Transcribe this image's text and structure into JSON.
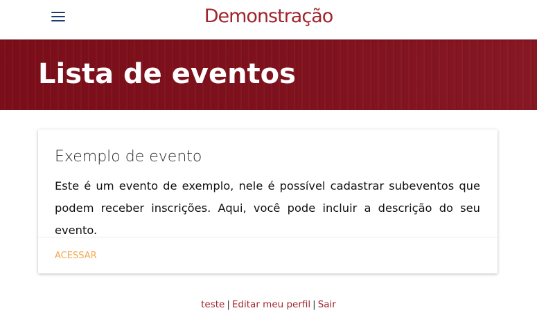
{
  "header": {
    "brand": "Demonstração",
    "menu_icon": "hamburger-menu-icon"
  },
  "hero": {
    "title": "Lista de eventos"
  },
  "events": [
    {
      "title": "Exemplo de evento",
      "description": "Este é um evento de exemplo, nele é possível cadastrar subeventos que podem receber inscrições. Aqui, você pode incluir a descrição do seu evento.",
      "action_label": "ACESSAR"
    }
  ],
  "footer": {
    "user_link": "teste",
    "separator": "|",
    "edit_profile_link": "Editar meu perfil",
    "logout_link": "Sair"
  },
  "colors": {
    "brand": "#a0262c",
    "hero_background": "#7a0f1a",
    "menu_icon": "#1f3b73",
    "action": "#f0a94e"
  }
}
